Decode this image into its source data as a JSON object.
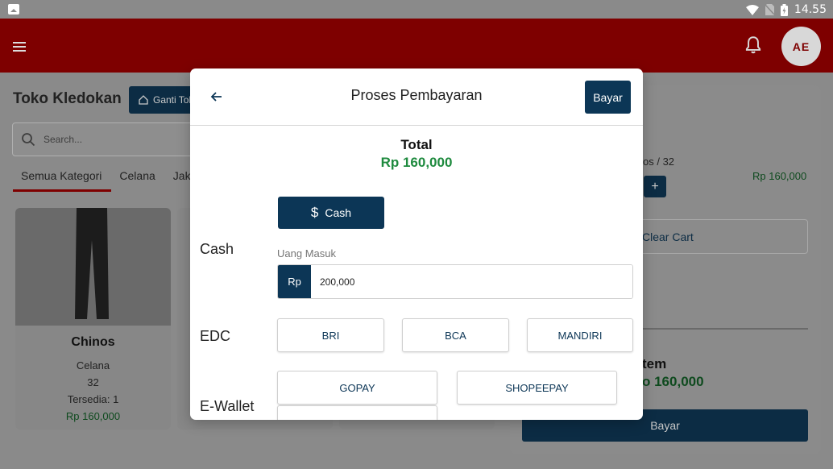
{
  "status_bar": {
    "time": "14.55"
  },
  "app_bar": {
    "avatar_initials": "AE"
  },
  "store": {
    "name": "Toko Kledokan",
    "switch_label": "Ganti Tok"
  },
  "search": {
    "placeholder": "Search..."
  },
  "categories": [
    "Semua Kategori",
    "Celana",
    "Jake"
  ],
  "product": {
    "name": "Chinos",
    "category": "Celana",
    "size": "32",
    "stock": "Tersedia: 1",
    "price": "Rp 160,000"
  },
  "cart": {
    "qty_text": "os / 32",
    "item_price": "Rp 160,000",
    "plus_label": "+",
    "clear_label": "Clear Cart",
    "items_label": "tem",
    "total": "o 160,000",
    "pay_label": "Bayar"
  },
  "modal": {
    "title": "Proses Pembayaran",
    "pay_label": "Bayar",
    "total_label": "Total",
    "total_value": "Rp 160,000",
    "cash_section": "Cash",
    "cash_button": "Cash",
    "amount_label": "Uang Masuk",
    "amount_prefix": "Rp",
    "amount_value": "200,000",
    "edc_section": "EDC",
    "edc_options": [
      "BRI",
      "BCA",
      "MANDIRI"
    ],
    "ewallet_section": "E-Wallet",
    "ewallet_options": [
      "GOPAY",
      "SHOPEEPAY"
    ]
  },
  "colors": {
    "primary": "#0c3656",
    "brand_red": "#8a0000",
    "price_green": "#1e8a3e"
  }
}
